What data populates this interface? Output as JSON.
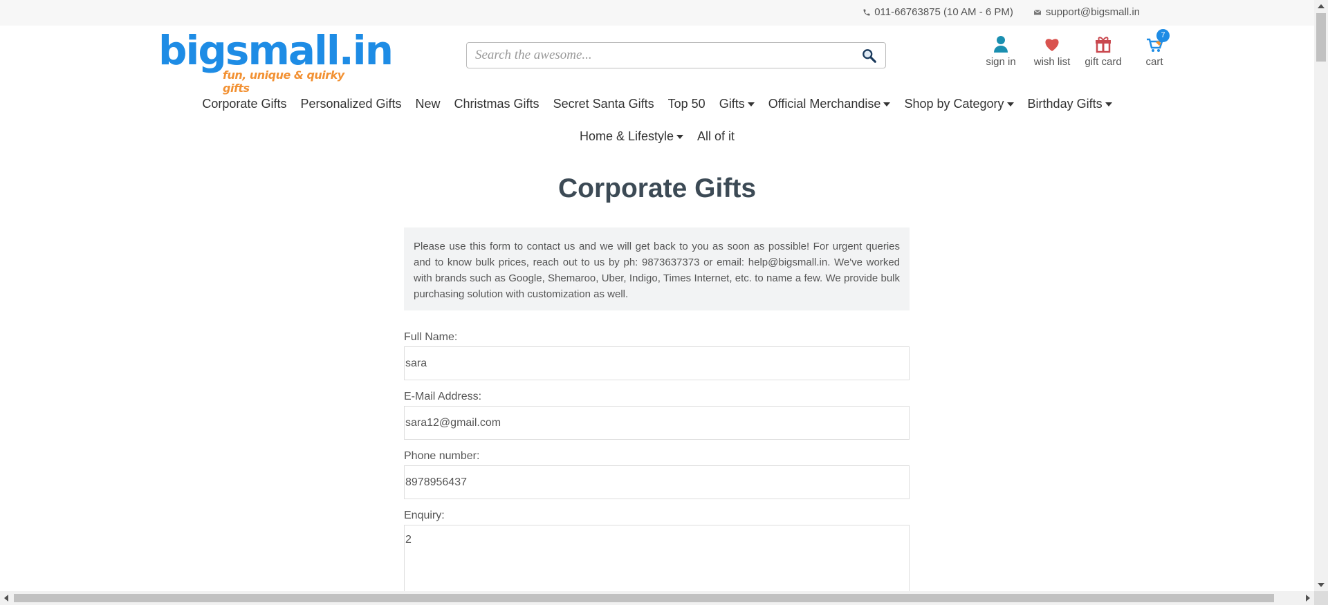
{
  "topbar": {
    "phone": "011-66763875 (10 AM - 6 PM)",
    "email": "support@bigsmall.in"
  },
  "header": {
    "logo_main": "bigsmall.in",
    "logo_tagline": "fun, unique & quirky gifts",
    "search_placeholder": "Search the awesome...",
    "icons": {
      "sign_in": "sign in",
      "wish_list": "wish list",
      "gift_card": "gift card",
      "cart": "cart",
      "cart_count": "7"
    }
  },
  "nav": {
    "row1": [
      {
        "label": "Corporate Gifts",
        "dropdown": false
      },
      {
        "label": "Personalized Gifts",
        "dropdown": false
      },
      {
        "label": "New",
        "dropdown": false
      },
      {
        "label": "Christmas Gifts",
        "dropdown": false
      },
      {
        "label": "Secret Santa Gifts",
        "dropdown": false
      },
      {
        "label": "Top 50",
        "dropdown": false
      },
      {
        "label": "Gifts",
        "dropdown": true
      },
      {
        "label": "Official Merchandise",
        "dropdown": true
      },
      {
        "label": "Shop by Category",
        "dropdown": true
      },
      {
        "label": "Birthday Gifts",
        "dropdown": true
      }
    ],
    "row2": [
      {
        "label": "Home & Lifestyle",
        "dropdown": true
      },
      {
        "label": "All of it",
        "dropdown": false
      }
    ]
  },
  "main": {
    "title": "Corporate Gifts",
    "info": "Please use this form to contact us and we will get back to you as soon as possible! For urgent queries and to know bulk prices, reach out to us by ph: 9873637373 or email: help@bigsmall.in. We've worked with brands such as Google, Shemaroo, Uber, Indigo, Times Internet, etc. to name a few. We provide bulk purchasing solution with customization as well.",
    "form": {
      "full_name_label": "Full Name:",
      "full_name_value": "sara",
      "email_label": "E-Mail Address:",
      "email_value": "sara12@gmail.com",
      "phone_label": "Phone number:",
      "phone_value": "8978956437",
      "enquiry_label": "Enquiry:",
      "enquiry_value": "2"
    }
  },
  "colors": {
    "brand_blue": "#1e8ce5",
    "brand_orange": "#f29133",
    "wishlist_red": "#d9534f",
    "giftcard_red": "#c9484f",
    "signin_teal": "#1a8fb0"
  }
}
